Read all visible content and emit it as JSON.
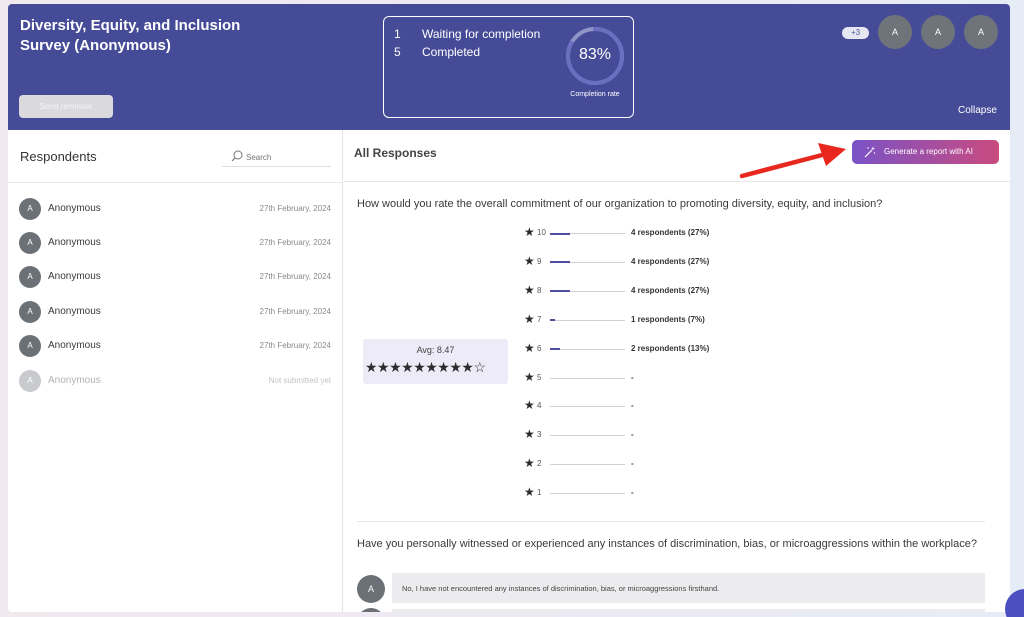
{
  "header": {
    "survey_title": "Diversity, Equity, and Inclusion Survey (Anonymous)",
    "send_reminder_label": "Send reminder",
    "stats": [
      {
        "count": "1",
        "label": "Waiting for completion"
      },
      {
        "count": "5",
        "label": "Completed"
      }
    ],
    "completion": {
      "percent_label": "83%",
      "value": 83,
      "caption": "Completion rate"
    },
    "more_badge": "+3",
    "avatars": [
      "A",
      "A",
      "A"
    ],
    "collapse_label": "Collapse"
  },
  "respondents": {
    "title": "Respondents",
    "search_placeholder": "Search",
    "items": [
      {
        "initial": "A",
        "name": "Anonymous",
        "date": "27th February, 2024",
        "submitted": true
      },
      {
        "initial": "A",
        "name": "Anonymous",
        "date": "27th February, 2024",
        "submitted": true
      },
      {
        "initial": "A",
        "name": "Anonymous",
        "date": "27th February, 2024",
        "submitted": true
      },
      {
        "initial": "A",
        "name": "Anonymous",
        "date": "27th February, 2024",
        "submitted": true
      },
      {
        "initial": "A",
        "name": "Anonymous",
        "date": "27th February, 2024",
        "submitted": true
      },
      {
        "initial": "A",
        "name": "Anonymous",
        "date": "Not submitted yet",
        "submitted": false
      }
    ]
  },
  "responses": {
    "title": "All Responses",
    "generate_report_label": "Generate a report with AI",
    "question1": {
      "text": "How would you rate the overall commitment of our organization to promoting diversity, equity, and inclusion?",
      "average_label": "Avg: 8.47",
      "average": 8.47,
      "average_stars": "★★★★★★★★★☆",
      "ratings": [
        {
          "rating": "10",
          "label": "4 respondents (27%)",
          "share": 0.27
        },
        {
          "rating": "9",
          "label": "4 respondents (27%)",
          "share": 0.27
        },
        {
          "rating": "8",
          "label": "4 respondents (27%)",
          "share": 0.27
        },
        {
          "rating": "7",
          "label": "1 respondents (7%)",
          "share": 0.07
        },
        {
          "rating": "6",
          "label": "2 respondents (13%)",
          "share": 0.13
        },
        {
          "rating": "5",
          "label": "-",
          "share": 0
        },
        {
          "rating": "4",
          "label": "-",
          "share": 0
        },
        {
          "rating": "3",
          "label": "-",
          "share": 0
        },
        {
          "rating": "2",
          "label": "-",
          "share": 0
        },
        {
          "rating": "1",
          "label": "-",
          "share": 0
        }
      ]
    },
    "question2": {
      "text": "Have you personally witnessed or experienced any instances of discrimination, bias, or microaggressions within the workplace?",
      "answers": [
        {
          "initial": "A",
          "text": "No, I have not encountered any instances of discrimination, bias, or microaggressions firsthand."
        }
      ]
    }
  },
  "colors": {
    "header_bg": "#454b97",
    "accent": "#4b4f9e",
    "button_gradient_start": "#7b53c6",
    "button_gradient_end": "#c94a7f",
    "annotation_arrow": "#e8281e"
  }
}
